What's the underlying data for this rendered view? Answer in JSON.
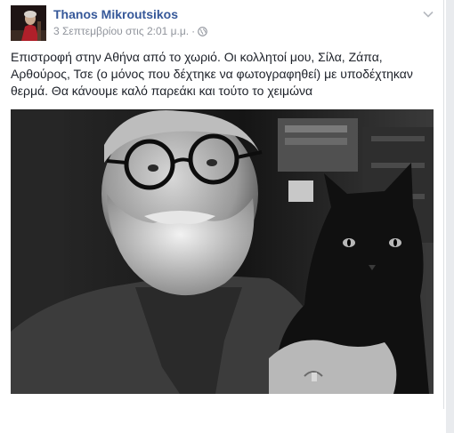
{
  "post": {
    "author": {
      "name": "Thanos Mikroutsikos"
    },
    "timestamp": "3 Σεπτεμβρίου στις 2:01 μ.μ.",
    "separator": "·",
    "privacy_icon": "globe-icon",
    "options_icon": "chevron-down-icon",
    "text": "Επιστροφή στην Αθήνα από το χωριό. Οι κολλητοί μου, Σίλα, Ζάπα, Αρθούρος, Τσε (ο μόνος που δέχτηκε να φωτογραφηθεί) με υποδέχτηκαν θερμά. Θα κάνουμε καλό παρεάκι και τούτο το χειμώνα",
    "photo_subject": "black-and-white photo of bearded man with round glasses holding a dark cat"
  },
  "colors": {
    "author_link": "#365899",
    "meta_text": "#90949c",
    "body_text": "#1d2129",
    "rail": "#e9ebee"
  }
}
